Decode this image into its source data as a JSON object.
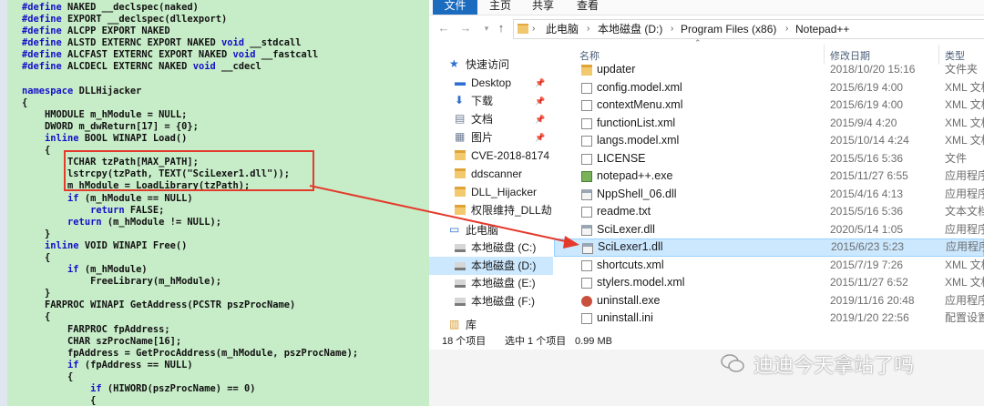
{
  "code": {
    "lines": [
      [
        [
          "kw",
          "#define"
        ],
        [
          "t",
          " NAKED __declspec(naked)"
        ]
      ],
      [
        [
          "kw",
          "#define"
        ],
        [
          "t",
          " EXPORT __declspec(dllexport)"
        ]
      ],
      [
        [
          "kw",
          "#define"
        ],
        [
          "t",
          " ALCPP EXPORT NAKED"
        ]
      ],
      [
        [
          "kw",
          "#define"
        ],
        [
          "t",
          " ALSTD EXTERNC EXPORT NAKED "
        ],
        [
          "kw",
          "void"
        ],
        [
          "t",
          " __stdcall"
        ]
      ],
      [
        [
          "kw",
          "#define"
        ],
        [
          "t",
          " ALCFAST EXTERNC EXPORT NAKED "
        ],
        [
          "kw",
          "void"
        ],
        [
          "t",
          " __fastcall"
        ]
      ],
      [
        [
          "kw",
          "#define"
        ],
        [
          "t",
          " ALCDECL EXTERNC NAKED "
        ],
        [
          "kw",
          "void"
        ],
        [
          "t",
          " __cdecl"
        ]
      ],
      [
        [
          "t",
          ""
        ]
      ],
      [
        [
          "kw",
          "namespace"
        ],
        [
          "t",
          " DLLHijacker"
        ]
      ],
      [
        [
          "t",
          "{"
        ]
      ],
      [
        [
          "t",
          "    HMODULE m_hModule = NULL;"
        ]
      ],
      [
        [
          "t",
          "    DWORD m_dwReturn[17] = {0};"
        ]
      ],
      [
        [
          "t",
          "    "
        ],
        [
          "kw",
          "inline"
        ],
        [
          "t",
          " BOOL WINAPI Load()"
        ]
      ],
      [
        [
          "t",
          "    {"
        ]
      ],
      [
        [
          "t",
          "        TCHAR tzPath[MAX_PATH];"
        ]
      ],
      [
        [
          "t",
          "        lstrcpy(tzPath, TEXT(\"SciLexer1.dll\"));"
        ]
      ],
      [
        [
          "t",
          "        m_hModule = LoadLibrary(tzPath);"
        ]
      ],
      [
        [
          "t",
          "        "
        ],
        [
          "kw",
          "if"
        ],
        [
          "t",
          " (m_hModule == NULL)"
        ]
      ],
      [
        [
          "t",
          "            "
        ],
        [
          "kw",
          "return"
        ],
        [
          "t",
          " FALSE;"
        ]
      ],
      [
        [
          "t",
          "        "
        ],
        [
          "kw",
          "return"
        ],
        [
          "t",
          " (m_hModule != NULL);"
        ]
      ],
      [
        [
          "t",
          "    }"
        ]
      ],
      [
        [
          "t",
          "    "
        ],
        [
          "kw",
          "inline"
        ],
        [
          "t",
          " VOID WINAPI Free()"
        ]
      ],
      [
        [
          "t",
          "    {"
        ]
      ],
      [
        [
          "t",
          "        "
        ],
        [
          "kw",
          "if"
        ],
        [
          "t",
          " (m_hModule)"
        ]
      ],
      [
        [
          "t",
          "            FreeLibrary(m_hModule);"
        ]
      ],
      [
        [
          "t",
          "    }"
        ]
      ],
      [
        [
          "t",
          "    FARPROC WINAPI GetAddress(PCSTR pszProcName)"
        ]
      ],
      [
        [
          "t",
          "    {"
        ]
      ],
      [
        [
          "t",
          "        FARPROC fpAddress;"
        ]
      ],
      [
        [
          "t",
          "        CHAR szProcName[16];"
        ]
      ],
      [
        [
          "t",
          "        fpAddress = GetProcAddress(m_hModule, pszProcName);"
        ]
      ],
      [
        [
          "t",
          "        "
        ],
        [
          "kw",
          "if"
        ],
        [
          "t",
          " (fpAddress == NULL)"
        ]
      ],
      [
        [
          "t",
          "        {"
        ]
      ],
      [
        [
          "t",
          "            "
        ],
        [
          "kw",
          "if"
        ],
        [
          "t",
          " (HIWORD(pszProcName) == 0)"
        ]
      ],
      [
        [
          "t",
          "            {"
        ]
      ]
    ]
  },
  "explorer": {
    "ribbon_tabs": {
      "file": "文件",
      "home": "主页",
      "share": "共享",
      "view": "查看"
    },
    "breadcrumb": [
      "此电脑",
      "本地磁盘 (D:)",
      "Program Files (x86)",
      "Notepad++"
    ],
    "nav_items": [
      {
        "label": "快速访问",
        "icon": "star-icon",
        "pinned": false,
        "indent": 0
      },
      {
        "label": "Desktop",
        "icon": "desktop-icon",
        "pinned": true,
        "indent": 1
      },
      {
        "label": "下载",
        "icon": "download-icon",
        "pinned": true,
        "indent": 1
      },
      {
        "label": "文档",
        "icon": "document-icon",
        "pinned": true,
        "indent": 1
      },
      {
        "label": "图片",
        "icon": "picture-icon",
        "pinned": true,
        "indent": 1
      },
      {
        "label": "CVE-2018-8174",
        "icon": "folder-icon",
        "pinned": false,
        "indent": 1
      },
      {
        "label": "ddscanner",
        "icon": "folder-icon",
        "pinned": false,
        "indent": 1
      },
      {
        "label": "DLL_Hijacker",
        "icon": "folder-icon",
        "pinned": false,
        "indent": 1
      },
      {
        "label": "权限维持_DLL劫",
        "icon": "folder-icon",
        "pinned": false,
        "indent": 1
      },
      {
        "label": "此电脑",
        "icon": "computer-icon",
        "pinned": false,
        "indent": 0
      },
      {
        "label": "本地磁盘 (C:)",
        "icon": "drive-icon",
        "pinned": false,
        "indent": 1
      },
      {
        "label": "本地磁盘 (D:)",
        "icon": "drive-icon",
        "pinned": false,
        "indent": 1
      },
      {
        "label": "本地磁盘 (E:)",
        "icon": "drive-icon",
        "pinned": false,
        "indent": 1
      },
      {
        "label": "本地磁盘 (F:)",
        "icon": "drive-icon",
        "pinned": false,
        "indent": 1
      },
      {
        "label": "库",
        "icon": "library-icon",
        "pinned": false,
        "indent": 0
      }
    ],
    "pin_glyph": "📌",
    "columns": {
      "name": "名称",
      "date": "修改日期",
      "type": "类型"
    },
    "files": [
      {
        "name": "updater",
        "date": "2018/10/20 15:16",
        "type": "文件夹",
        "icon": "folder"
      },
      {
        "name": "config.model.xml",
        "date": "2015/6/19 4:00",
        "type": "XML 文档",
        "icon": "doc"
      },
      {
        "name": "contextMenu.xml",
        "date": "2015/6/19 4:00",
        "type": "XML 文档",
        "icon": "doc"
      },
      {
        "name": "functionList.xml",
        "date": "2015/9/4 4:20",
        "type": "XML 文档",
        "icon": "doc"
      },
      {
        "name": "langs.model.xml",
        "date": "2015/10/14 4:24",
        "type": "XML 文档",
        "icon": "doc"
      },
      {
        "name": "LICENSE",
        "date": "2015/5/16 5:36",
        "type": "文件",
        "icon": "doc"
      },
      {
        "name": "notepad++.exe",
        "date": "2015/11/27 6:55",
        "type": "应用程序",
        "icon": "exe"
      },
      {
        "name": "NppShell_06.dll",
        "date": "2015/4/16 4:13",
        "type": "应用程序",
        "icon": "dll"
      },
      {
        "name": "readme.txt",
        "date": "2015/5/16 5:36",
        "type": "文本文档",
        "icon": "doc"
      },
      {
        "name": "SciLexer.dll",
        "date": "2020/5/14 1:05",
        "type": "应用程序",
        "icon": "dll"
      },
      {
        "name": "SciLexer1.dll",
        "date": "2015/6/23 5:23",
        "type": "应用程序",
        "icon": "dll",
        "selected": true
      },
      {
        "name": "shortcuts.xml",
        "date": "2015/7/19 7:26",
        "type": "XML 文档",
        "icon": "doc"
      },
      {
        "name": "stylers.model.xml",
        "date": "2015/11/27 6:52",
        "type": "XML 文档",
        "icon": "doc"
      },
      {
        "name": "uninstall.exe",
        "date": "2019/11/16 20:48",
        "type": "应用程序",
        "icon": "unexe"
      },
      {
        "name": "uninstall.ini",
        "date": "2019/1/20 22:56",
        "type": "配置设置",
        "icon": "doc"
      }
    ],
    "status": {
      "count": "18 个项目",
      "selection": "选中 1 个项目",
      "size": "0.99 MB"
    }
  },
  "watermark": "迪迪今天拿站了吗",
  "colors": {
    "accent": "#1b6bbf",
    "code_bg": "#c7ecc8",
    "keyword": "#1510c8",
    "highlight": "#e43a2c",
    "selection": "#cce8ff"
  }
}
